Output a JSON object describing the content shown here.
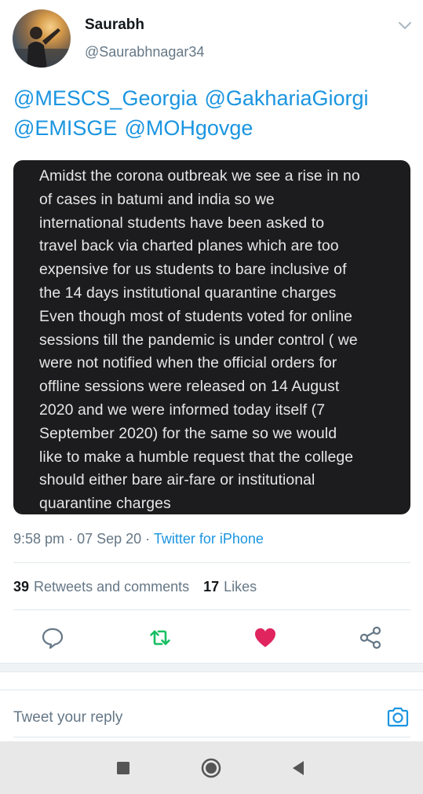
{
  "user": {
    "name": "Saurabh",
    "handle": "@Saurabhnagar34"
  },
  "tweet": {
    "mentions": [
      "@MESCS_Georgia",
      "@GakhariaGiorgi",
      "@EMISGE",
      "@MOHgovge"
    ],
    "image_text_lines": [
      "Amidst the corona outbreak we see a rise in no",
      "of cases in batumi and india  so we",
      "international students have been asked to",
      "travel back via charted planes which are too",
      "expensive for us students to bare inclusive of",
      "the 14 days institutional quarantine charges",
      "Even though most of students voted for online",
      "sessions till the pandemic is under control ( we",
      "were not notified when the official orders for",
      "offline sessions were released on 14 August",
      "2020 and we were informed today itself (7",
      "September 2020) for the same so we would",
      "like to make a humble request that the college",
      "should either bare air-fare or institutional",
      "quarantine charges"
    ],
    "time": "9:58 pm",
    "separator": "·",
    "date": "07 Sep 20",
    "source": "Twitter for iPhone"
  },
  "stats": {
    "retweets_count": "39",
    "retweets_label": "Retweets and comments",
    "likes_count": "17",
    "likes_label": "Likes"
  },
  "reply": {
    "placeholder": "Tweet your reply"
  },
  "colors": {
    "link": "#1b95e0",
    "retweet_green": "#17bf63",
    "like_red": "#e0245e",
    "secondary_text": "#657786"
  },
  "icons": {
    "caret": "chevron-down-icon",
    "reply": "comment-bubble-icon",
    "retweet": "retweet-icon",
    "like": "heart-icon",
    "share": "share-icon",
    "camera": "camera-icon",
    "nav_recent": "square-icon",
    "nav_home": "circle-icon",
    "nav_back": "triangle-back-icon"
  }
}
